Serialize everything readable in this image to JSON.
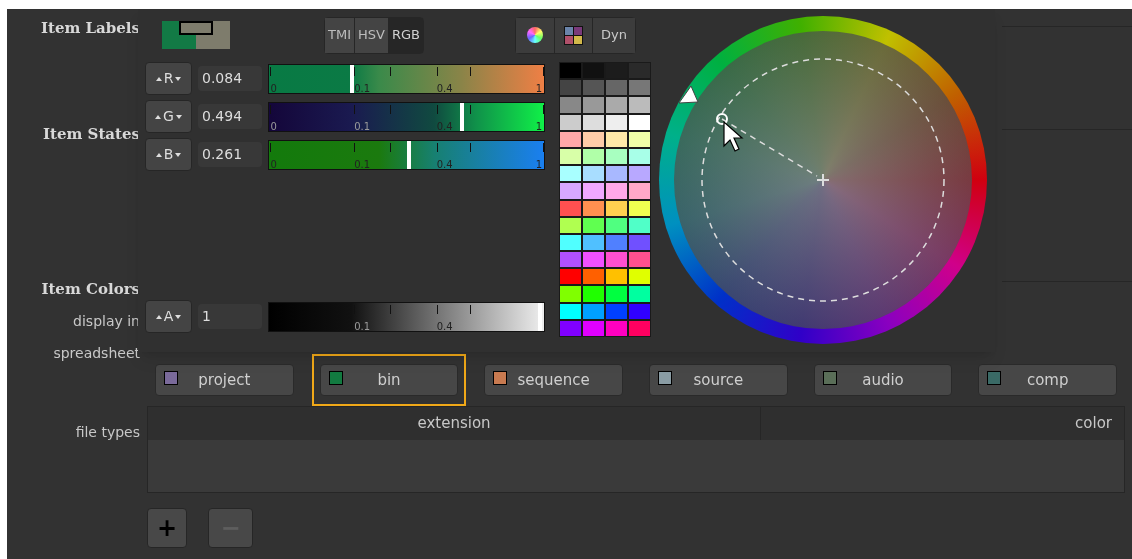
{
  "section_labels": [
    {
      "text": "Item Labels",
      "kind": "heading"
    },
    {
      "text": "Item States",
      "kind": "heading"
    },
    {
      "text": "Item Colors",
      "kind": "heading"
    },
    {
      "text": "display in",
      "kind": "plain"
    },
    {
      "text": "spreadsheet",
      "kind": "plain"
    }
  ],
  "color_picker": {
    "modes": [
      {
        "label": "TMI",
        "selected": false
      },
      {
        "label": "HSV",
        "selected": false
      },
      {
        "label": "RGB",
        "selected": true
      }
    ],
    "view_buttons": [
      {
        "kind": "wheel"
      },
      {
        "kind": "palette"
      },
      {
        "kind": "text",
        "label": "Dyn"
      }
    ],
    "channels": [
      {
        "key": "R",
        "value": "0.084",
        "level": 0.3,
        "tick_labels": [
          "0",
          "0.1",
          "0.4",
          "1"
        ]
      },
      {
        "key": "G",
        "value": "0.494",
        "level": 0.7,
        "tick_labels": [
          "0",
          "0.1",
          "0.4",
          "1"
        ]
      },
      {
        "key": "B",
        "value": "0.261",
        "level": 0.51,
        "tick_labels": [
          "0",
          "0.1",
          "0.4",
          "1"
        ]
      },
      {
        "key": "A",
        "value": "1",
        "level": 0.985,
        "tick_labels": [
          "0.1",
          "0.4"
        ]
      }
    ]
  },
  "categories": [
    {
      "label": "project",
      "color": "#7a6a9a",
      "selected": false
    },
    {
      "label": "bin",
      "color": "#127a40",
      "selected": true
    },
    {
      "label": "sequence",
      "color": "#c87a50",
      "selected": false
    },
    {
      "label": "source",
      "color": "#8a9ca4",
      "selected": false
    },
    {
      "label": "audio",
      "color": "#5a6e58",
      "selected": false
    },
    {
      "label": "comp",
      "color": "#3a6a66",
      "selected": false
    }
  ],
  "file_types": {
    "label": "file types",
    "columns": [
      "extension",
      "color"
    ]
  },
  "buttons": [
    {
      "label": "+",
      "disabled": false
    },
    {
      "label": "−",
      "disabled": true
    }
  ]
}
